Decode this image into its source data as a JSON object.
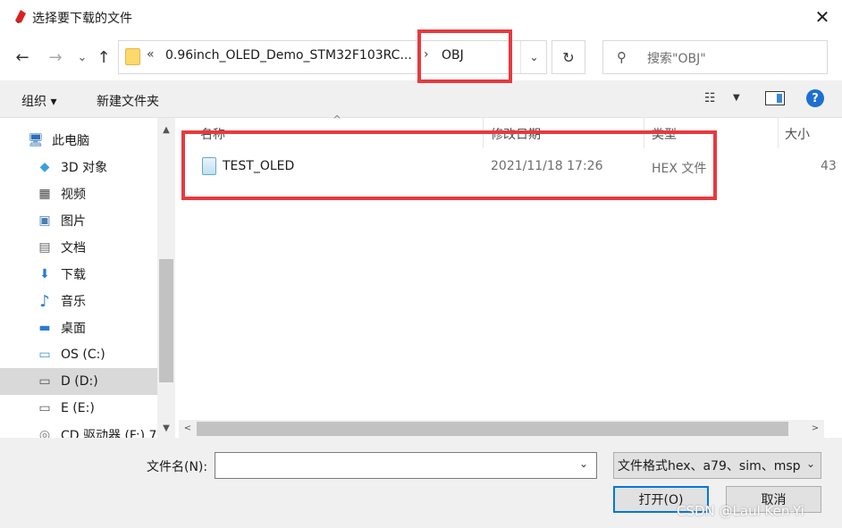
{
  "window": {
    "title": "选择要下载的文件",
    "close_glyph": "✕"
  },
  "nav": {
    "back_glyph": "←",
    "forward_glyph": "→",
    "recent_glyph": "⌄",
    "up_glyph": "↑",
    "address": {
      "overflow_glyph": "«",
      "parent_path": "0.96inch_OLED_Demo_STM32F103RC...",
      "separator": "›",
      "current": "OBJ",
      "dropdown_glyph": "⌄"
    },
    "refresh_glyph": "↻",
    "search": {
      "icon_glyph": "⚲",
      "placeholder": "搜索\"OBJ\""
    }
  },
  "toolbar": {
    "organize_label": "组织 ▾",
    "new_folder_label": "新建文件夹",
    "view_glyph": "☷",
    "view_drop_glyph": "▼",
    "help_glyph": "?"
  },
  "sidebar": {
    "items": [
      {
        "label": "此电脑",
        "icon": "computer-icon",
        "glyph": "🖥"
      },
      {
        "label": "3D 对象",
        "icon": "cube-icon",
        "glyph": "◆"
      },
      {
        "label": "视频",
        "icon": "video-icon",
        "glyph": "▦"
      },
      {
        "label": "图片",
        "icon": "picture-icon",
        "glyph": "▣"
      },
      {
        "label": "文档",
        "icon": "document-icon",
        "glyph": "▤"
      },
      {
        "label": "下载",
        "icon": "download-icon",
        "glyph": "⬇"
      },
      {
        "label": "音乐",
        "icon": "music-icon",
        "glyph": "♪"
      },
      {
        "label": "桌面",
        "icon": "desktop-icon",
        "glyph": "▬"
      },
      {
        "label": "OS (C:)",
        "icon": "drive-c-icon",
        "glyph": "▭"
      },
      {
        "label": "D (D:)",
        "icon": "drive-d-icon",
        "glyph": "▭",
        "selected": true
      },
      {
        "label": "E (E:)",
        "icon": "drive-e-icon",
        "glyph": "▭"
      },
      {
        "label": "CD 驱动器 (F:) 7",
        "icon": "cd-drive-icon",
        "glyph": "◎"
      }
    ],
    "scroll_up_glyph": "▲",
    "scroll_down_glyph": "▼"
  },
  "file_list": {
    "columns": [
      "名称",
      "修改日期",
      "类型",
      "大小"
    ],
    "sort_glyph": "^",
    "rows": [
      {
        "name": "TEST_OLED",
        "modified": "2021/11/18 17:26",
        "type": "HEX 文件",
        "size": "43"
      }
    ],
    "hscroll_left_glyph": "<",
    "hscroll_right_glyph": ">"
  },
  "bottom": {
    "filename_label": "文件名(N):",
    "filename_value": "",
    "filename_drop_glyph": "⌄",
    "filter_value": "文件格式hex、a79、sim、msp",
    "filter_drop_glyph": "⌄",
    "open_label": "打开(O)",
    "cancel_label": "取消"
  },
  "watermark": "CSDN @Laul Ken-Yi",
  "colors": {
    "highlight": "#e8393e",
    "selection": "#d9d9d9",
    "accent": "#0078d7"
  }
}
